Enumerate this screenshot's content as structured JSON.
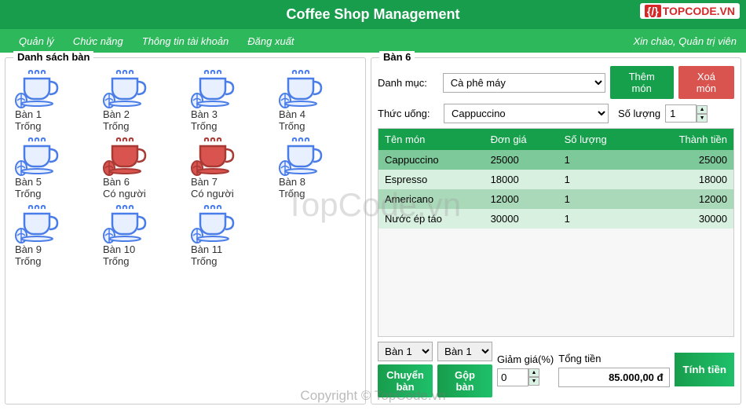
{
  "header": {
    "title": "Coffee Shop Management",
    "logo_text": "TOPCODE.VN"
  },
  "menu": {
    "items": [
      "Quản lý",
      "Chức năng",
      "Thông tin tài khoản",
      "Đăng xuất"
    ],
    "welcome": "Xin chào, Quản trị viên"
  },
  "left": {
    "title": "Danh sách bàn",
    "tables": [
      {
        "name": "Bàn 1",
        "status": "Trống",
        "occupied": false
      },
      {
        "name": "Bàn 2",
        "status": "Trống",
        "occupied": false
      },
      {
        "name": "Bàn 3",
        "status": "Trống",
        "occupied": false
      },
      {
        "name": "Bàn 4",
        "status": "Trống",
        "occupied": false
      },
      {
        "name": "Bàn 5",
        "status": "Trống",
        "occupied": false
      },
      {
        "name": "Bàn 6",
        "status": "Có người",
        "occupied": true
      },
      {
        "name": "Bàn 7",
        "status": "Có người",
        "occupied": true
      },
      {
        "name": "Bàn 8",
        "status": "Trống",
        "occupied": false
      },
      {
        "name": "Bàn 9",
        "status": "Trống",
        "occupied": false
      },
      {
        "name": "Bàn 10",
        "status": "Trống",
        "occupied": false
      },
      {
        "name": "Bàn 11",
        "status": "Trống",
        "occupied": false
      }
    ]
  },
  "right": {
    "title": "Bàn 6",
    "category_label": "Danh mục:",
    "category_value": "Cà phê máy",
    "drink_label": "Thức uống:",
    "drink_value": "Cappuccino",
    "add_btn": "Thêm món",
    "remove_btn": "Xoá món",
    "qty_label": "Số lượng",
    "qty_value": "1",
    "columns": [
      "Tên món",
      "Đơn giá",
      "Số lượng",
      "Thành tiền"
    ],
    "rows": [
      {
        "name": "Cappuccino",
        "price": "25000",
        "qty": "1",
        "total": "25000"
      },
      {
        "name": "Espresso",
        "price": "18000",
        "qty": "1",
        "total": "18000"
      },
      {
        "name": "Americano",
        "price": "12000",
        "qty": "1",
        "total": "12000"
      },
      {
        "name": "Nước ép táo",
        "price": "30000",
        "qty": "1",
        "total": "30000"
      }
    ],
    "move_from": "Bàn 1",
    "move_to": "Bàn 1",
    "move_btn": "Chuyển bàn",
    "merge_btn": "Gộp bàn",
    "discount_label": "Giảm giá(%)",
    "discount_value": "0",
    "total_label": "Tổng tiền",
    "total_value": "85.000,00 đ",
    "calc_btn": "Tính tiền"
  },
  "watermark": "TopCode.vn",
  "copyright": "Copyright © TopCode.vn"
}
